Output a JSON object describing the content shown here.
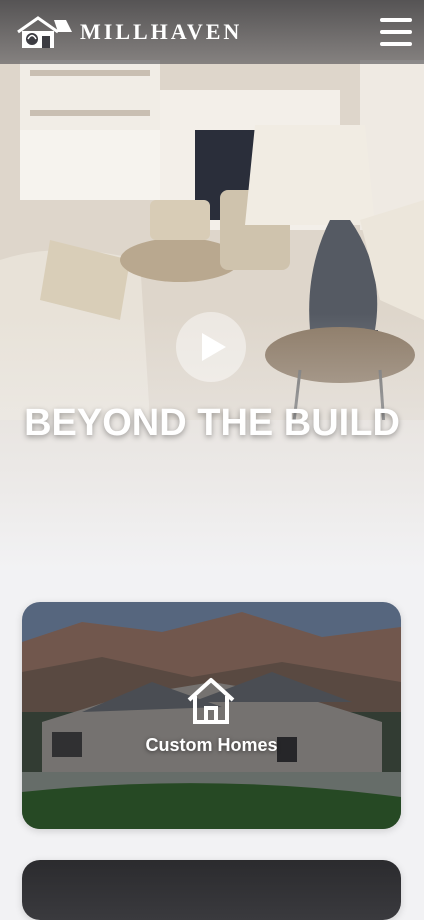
{
  "header": {
    "brand_name": "MILLHAVEN",
    "logo_icon": "house-logo-icon",
    "menu_icon": "hamburger-menu-icon"
  },
  "hero": {
    "title": "BEYOND THE BUILD",
    "play_icon": "play-icon"
  },
  "cards": [
    {
      "label": "Custom Homes",
      "icon": "house-outline-icon"
    },
    {
      "label": ""
    }
  ],
  "colors": {
    "header_bg": "#3c3c42",
    "text_light": "#ffffff",
    "page_bg": "#f2f2f4"
  }
}
